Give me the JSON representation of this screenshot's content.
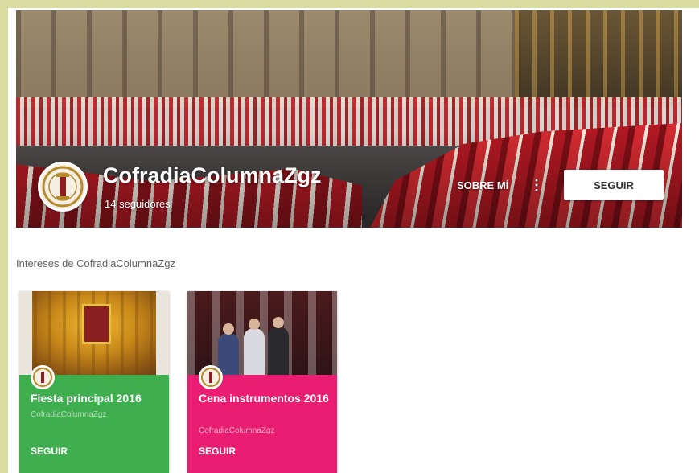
{
  "profile": {
    "name": "CofradiaColumnaZgz",
    "followers": "14 seguidores",
    "about_label": "SOBRE MÍ",
    "more_label": "⋮",
    "follow_label": "SEGUIR"
  },
  "interests": {
    "title": "Intereses de CofradiaColumnaZgz"
  },
  "cards": [
    {
      "title": "Fiesta principal 2016",
      "author": "CofradiaColumnaZgz",
      "follow_label": "SEGUIR",
      "color": "#3fae4f"
    },
    {
      "title": "Cena instrumentos 2016",
      "author": "CofradiaColumnaZgz",
      "follow_label": "SEGUIR",
      "color": "#e91e72"
    }
  ],
  "icons": {
    "avatar": "brotherhood-emblem-icon",
    "more": "more-vert-icon"
  }
}
